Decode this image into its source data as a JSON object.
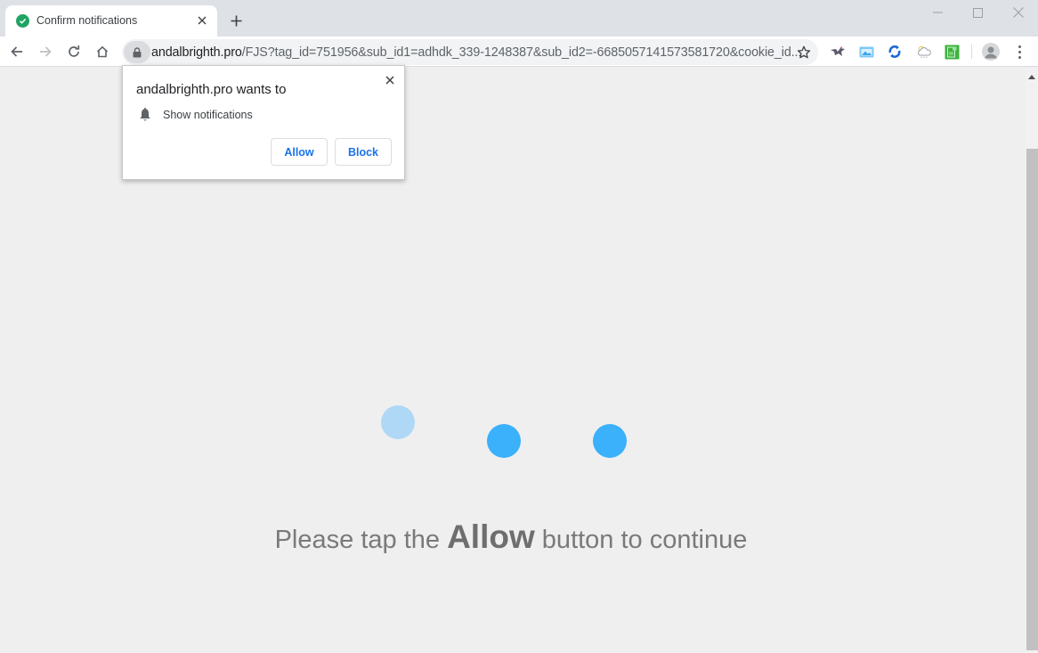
{
  "browser": {
    "tab": {
      "title": "Confirm notifications",
      "favicon": "check-circle-icon",
      "favicon_color": "#1fa463"
    },
    "window_controls": [
      "minimize",
      "maximize",
      "close"
    ],
    "toolbar": {
      "url_host": "andalbrighth.pro",
      "url_rest": "/FJS?tag_id=751956&sub_id1=adhdk_339-1248387&sub_id2=-6685057141573581720&cookie_id...",
      "extensions": [
        "extension-bird-icon",
        "extension-image-icon",
        "extension-sync-icon",
        "extension-weather-icon",
        "extension-green-doc-icon"
      ]
    }
  },
  "permission_prompt": {
    "title": "andalbrighth.pro wants to",
    "permission": "Show notifications",
    "allow_label": "Allow",
    "block_label": "Block",
    "accent_color": "#1a73e8"
  },
  "page": {
    "loader_dots": [
      {
        "color": "#aed8f6"
      },
      {
        "color": "#3bb0fb"
      },
      {
        "color": "#3bb0fb"
      }
    ],
    "message_before": "Please tap the ",
    "message_strong": "Allow",
    "message_after": " button to continue",
    "text_color": "#7a7a7a",
    "background": "#efefef"
  }
}
